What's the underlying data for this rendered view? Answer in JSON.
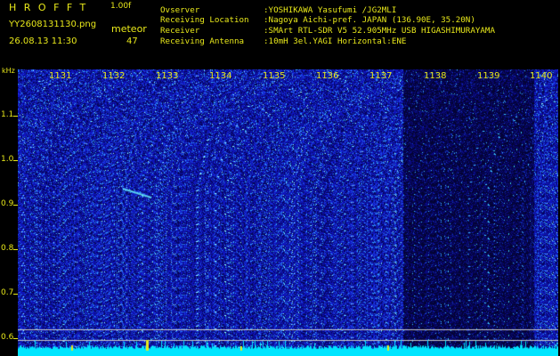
{
  "header": {
    "app_title": "HROFFT",
    "version": "1.00f",
    "filename": "YY2608131130.png",
    "meteor_label": "meteor",
    "datetime": "26.08.13 11:30",
    "meteor_count": "47"
  },
  "info": {
    "observer_key": "Ovserver",
    "observer_val": ":YOSHIKAWA Yasufumi /JG2MLI",
    "location_key": "Receiving Location",
    "location_val": ":Nagoya Aichi-pref. JAPAN (136.90E, 35.20N)",
    "receiver_key": "Receiver",
    "receiver_val": ":SMArt RTL-SDR V5 52.905MHz USB HIGASHIMURAYAMA",
    "antenna_key": "Receiving Antenna",
    "antenna_val": ":10mH 3el.YAGI Horizontal:ENE"
  },
  "axis": {
    "unit": "kHz",
    "y_labels": [
      "1.1",
      "1.0",
      "0.9",
      "0.8",
      "0.7",
      "0.6"
    ],
    "x_labels": [
      "1131",
      "1132",
      "1133",
      "1134",
      "1135",
      "1136",
      "1137",
      "1138",
      "1139",
      "1140"
    ]
  },
  "colors": {
    "text": "#e8e81a",
    "waterfall_bg": "#0a0a8a",
    "waterfall_dark": "#060640",
    "signal": "#40e0ff",
    "baseline": "#00e5ff"
  }
}
